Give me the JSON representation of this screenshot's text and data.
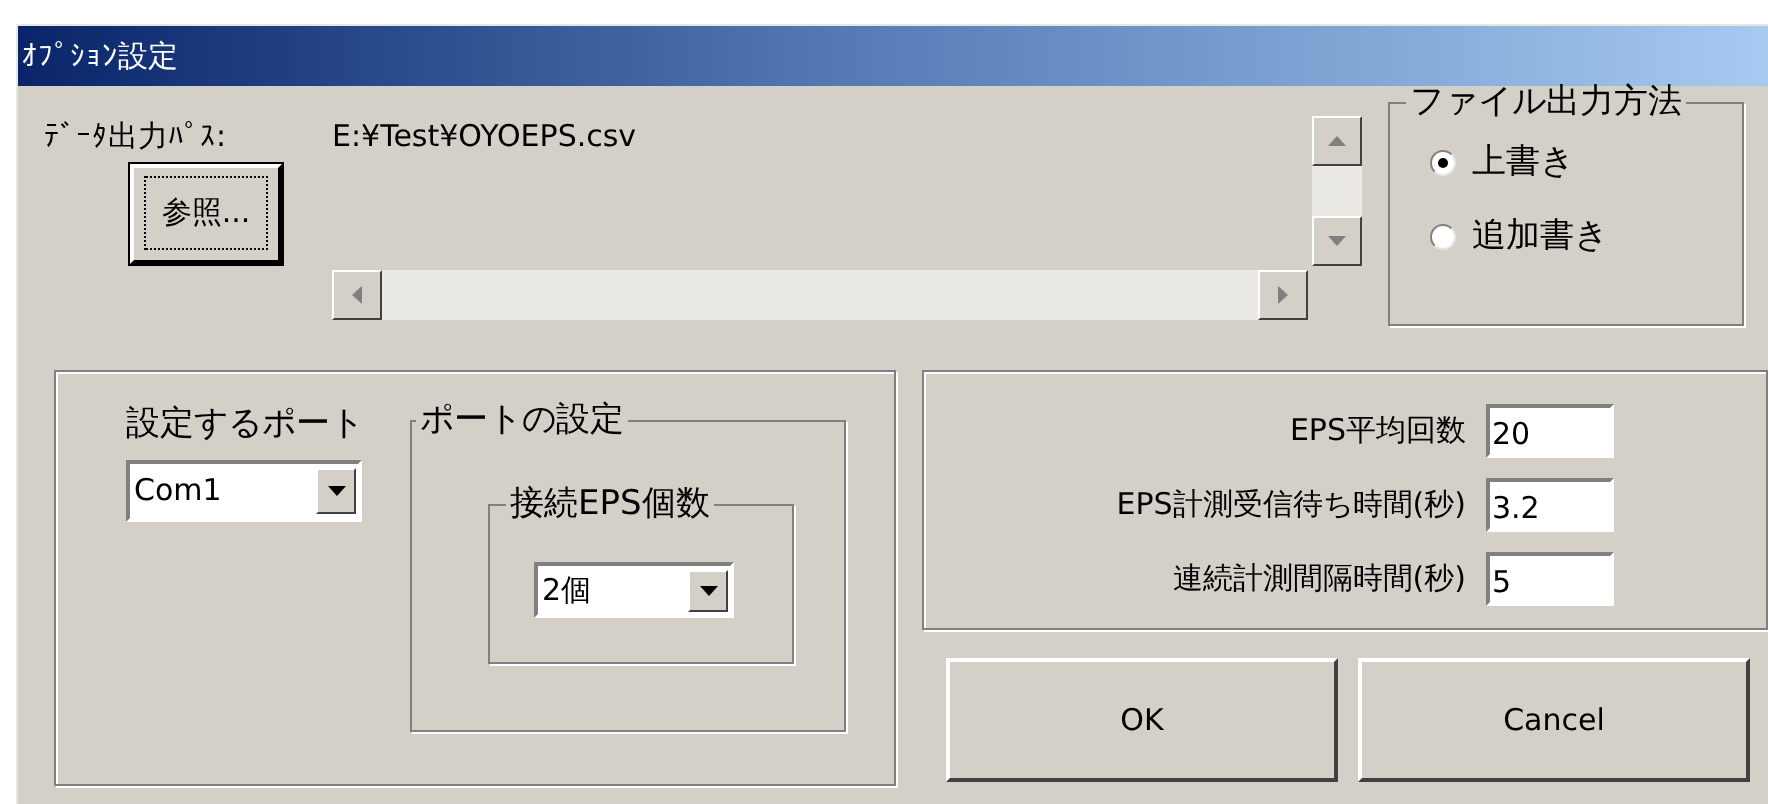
{
  "window": {
    "title": "ｵﾌﾟｼｮﾝ設定"
  },
  "data_output": {
    "label": "ﾃﾞｰﾀ出力ﾊﾟｽ:",
    "path": "E:¥Test¥OYOEPS.csv",
    "browse_button": "参照..."
  },
  "file_output_method": {
    "title": "ファイル出力方法",
    "options": [
      {
        "label": "上書き",
        "selected": true
      },
      {
        "label": "追加書き",
        "selected": false
      }
    ]
  },
  "port": {
    "label": "設定するポート",
    "value": "Com1"
  },
  "port_settings": {
    "title": "ポートの設定",
    "eps_count": {
      "title": "接続EPS個数",
      "value": "2個"
    }
  },
  "measurement": [
    {
      "label": "EPS平均回数",
      "value": "20"
    },
    {
      "label": "EPS計測受信待ち時間(秒)",
      "value": "3.2"
    },
    {
      "label": "連続計測間隔時間(秒)",
      "value": "5"
    }
  ],
  "buttons": [
    "OK",
    "Cancel"
  ]
}
